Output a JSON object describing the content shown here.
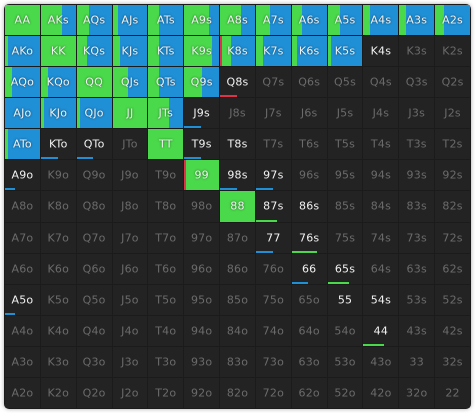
{
  "colors": {
    "raise": "#4ad94a",
    "call": "#1f8fd6",
    "allin": "#e0304a",
    "text_active": "#f2f2f2",
    "text_inactive": "#6b6b6b"
  },
  "ranks": [
    "A",
    "K",
    "Q",
    "J",
    "T",
    "9",
    "8",
    "7",
    "6",
    "5",
    "4",
    "3",
    "2"
  ],
  "hands": [
    [
      "AA",
      "AKs",
      "AQs",
      "AJs",
      "ATs",
      "A9s",
      "A8s",
      "A7s",
      "A6s",
      "A5s",
      "A4s",
      "A3s",
      "A2s"
    ],
    [
      "AKo",
      "KK",
      "KQs",
      "KJs",
      "KTs",
      "K9s",
      "K8s",
      "K7s",
      "K6s",
      "K5s",
      "K4s",
      "K3s",
      "K2s"
    ],
    [
      "AQo",
      "KQo",
      "QQ",
      "QJs",
      "QTs",
      "Q9s",
      "Q8s",
      "Q7s",
      "Q6s",
      "Q5s",
      "Q4s",
      "Q3s",
      "Q2s"
    ],
    [
      "AJo",
      "KJo",
      "QJo",
      "JJ",
      "JTs",
      "J9s",
      "J8s",
      "J7s",
      "J6s",
      "J5s",
      "J4s",
      "J3s",
      "J2s"
    ],
    [
      "ATo",
      "KTo",
      "QTo",
      "JTo",
      "TT",
      "T9s",
      "T8s",
      "T7s",
      "T6s",
      "T5s",
      "T4s",
      "T3s",
      "T2s"
    ],
    [
      "A9o",
      "K9o",
      "Q9o",
      "J9o",
      "T9o",
      "99",
      "98s",
      "97s",
      "96s",
      "95s",
      "94s",
      "93s",
      "92s"
    ],
    [
      "A8o",
      "K8o",
      "Q8o",
      "J8o",
      "T8o",
      "98o",
      "88",
      "87s",
      "86s",
      "85s",
      "84s",
      "83s",
      "82s"
    ],
    [
      "A7o",
      "K7o",
      "Q7o",
      "J7o",
      "T7o",
      "97o",
      "87o",
      "77",
      "76s",
      "75s",
      "74s",
      "73s",
      "72s"
    ],
    [
      "A6o",
      "K6o",
      "Q6o",
      "J6o",
      "T6o",
      "96o",
      "86o",
      "76o",
      "66",
      "65s",
      "64s",
      "63s",
      "62s"
    ],
    [
      "A5o",
      "K5o",
      "Q5o",
      "J5o",
      "T5o",
      "95o",
      "85o",
      "75o",
      "65o",
      "55",
      "54s",
      "53s",
      "52s"
    ],
    [
      "A4o",
      "K4o",
      "Q4o",
      "J4o",
      "T4o",
      "94o",
      "84o",
      "74o",
      "64o",
      "54o",
      "44",
      "43s",
      "42s"
    ],
    [
      "A3o",
      "K3o",
      "Q3o",
      "J3o",
      "T3o",
      "93o",
      "83o",
      "73o",
      "63o",
      "53o",
      "43o",
      "33",
      "32s"
    ],
    [
      "A2o",
      "K2o",
      "Q2o",
      "J2o",
      "T2o",
      "92o",
      "82o",
      "72o",
      "62o",
      "52o",
      "42o",
      "32o",
      "22"
    ]
  ],
  "strategy": {
    "AA": {
      "raise": 1.0
    },
    "AKs": {
      "raise": 0.6,
      "call": 0.4
    },
    "AQs": {
      "raise": 0.35,
      "call": 0.65
    },
    "AJs": {
      "raise": 0.15,
      "call": 0.85
    },
    "ATs": {
      "raise": 0.3,
      "call": 0.7
    },
    "A9s": {
      "raise": 0.7,
      "call": 0.3
    },
    "A8s": {
      "raise": 0.6,
      "call": 0.4
    },
    "A7s": {
      "raise": 0.4,
      "call": 0.6
    },
    "A6s": {
      "raise": 0.3,
      "call": 0.7
    },
    "A5s": {
      "raise": 0.35,
      "call": 0.65
    },
    "A4s": {
      "raise": 0.2,
      "call": 0.8
    },
    "A3s": {
      "raise": 0.2,
      "call": 0.8
    },
    "A2s": {
      "raise": 0.25,
      "call": 0.75
    },
    "AKo": {
      "raise": 0.1,
      "call": 0.9
    },
    "KK": {
      "raise": 1.0
    },
    "KQs": {
      "raise": 0.3,
      "call": 0.7
    },
    "KJs": {
      "raise": 0.2,
      "call": 0.8
    },
    "KTs": {
      "raise": 0.3,
      "call": 0.7
    },
    "K9s": {
      "raise": 0.8,
      "call": 0.2
    },
    "K8s": {
      "allin": 0.05,
      "raise": 0.25,
      "call": 0.7
    },
    "K7s": {
      "raise": 0.2,
      "call": 0.8
    },
    "K6s": {
      "raise": 0.15,
      "call": 0.85
    },
    "K5s": {
      "raise": 0.1,
      "call": 0.9
    },
    "K4s": {
      "active": true
    },
    "AQo": {
      "raise": 0.2,
      "call": 0.8
    },
    "KQo": {
      "raise": 0.2,
      "call": 0.8
    },
    "QQ": {
      "raise": 1.0
    },
    "QJs": {
      "raise": 0.45,
      "call": 0.55
    },
    "QTs": {
      "raise": 0.3,
      "call": 0.7
    },
    "Q9s": {
      "raise": 0.5,
      "call": 0.5
    },
    "Q8s": {
      "allin": 0.08
    },
    "AJo": {
      "call": 1.0
    },
    "KJo": {
      "raise": 0.1,
      "call": 0.9
    },
    "QJo": {
      "raise": 0.1,
      "call": 0.9
    },
    "JJ": {
      "raise": 1.0
    },
    "JTs": {
      "raise": 0.6,
      "call": 0.4
    },
    "J9s": {
      "call": 0.08
    },
    "ATo": {
      "raise": 0.1,
      "call": 0.9
    },
    "KTo": {
      "call": 0.08
    },
    "QTo": {
      "call": 0.08
    },
    "TT": {
      "raise": 1.0
    },
    "T9s": {
      "call": 0.08
    },
    "T8s": {
      "active": true
    },
    "A9o": {
      "call": 0.05
    },
    "99": {
      "allin": 0.05,
      "raise": 0.95
    },
    "98s": {
      "call": 0.08
    },
    "97s": {
      "call": 0.08
    },
    "88": {
      "raise": 1.0
    },
    "87s": {
      "raise": 0.1
    },
    "86s": {
      "active": true
    },
    "77": {
      "call": 0.08
    },
    "76s": {
      "raise": 0.12
    },
    "66": {
      "call": 0.08
    },
    "65s": {
      "raise": 0.1
    },
    "A5o": {
      "call": 0.05
    },
    "55": {
      "active": true
    },
    "54s": {
      "active": true
    },
    "44": {
      "raise": 0.1
    }
  }
}
